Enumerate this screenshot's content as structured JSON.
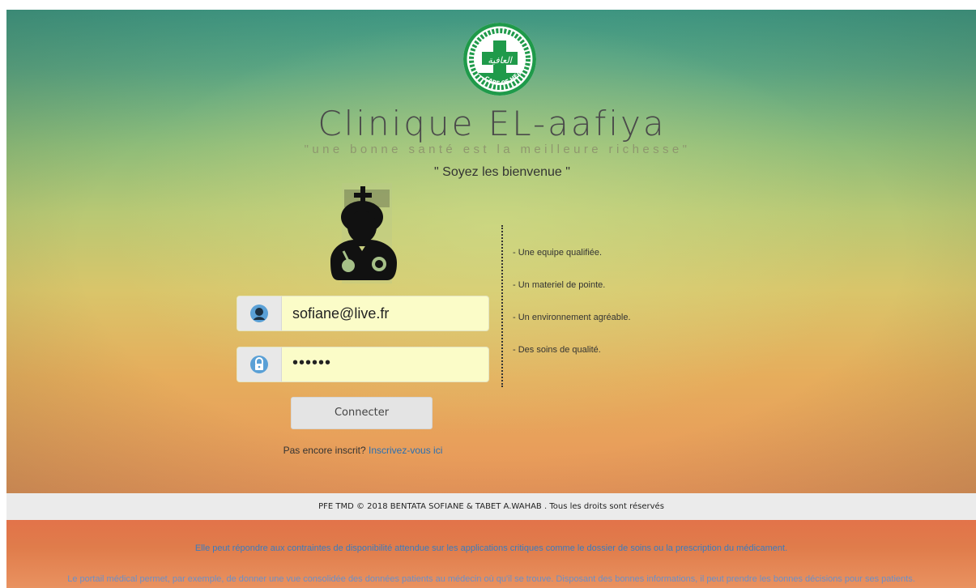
{
  "header": {
    "title": "Clinique EL-aafiya",
    "tagline": "\"une bonne santé est la meilleure richesse\"",
    "welcome": "\" Soyez les bienvenue \"",
    "logo_text": "CARE OF HEALTH"
  },
  "login": {
    "email_value": "sofiane@live.fr",
    "password_value": "••••••",
    "submit_label": "Connecter",
    "signup_prompt": "Pas encore inscrit?",
    "signup_link": "Inscrivez-vous ici"
  },
  "features": [
    "- Une equipe qualifiée.",
    "- Un materiel de pointe.",
    "- Un environnement agréable.",
    "- Des soins de qualité."
  ],
  "footer": {
    "copyright": "PFE TMD © 2018 BENTATA SOFIANE & TABET A.WAHAB . Tous les droits sont réservés",
    "para1": "Elle peut répondre aux contraintes de disponibilité attendue sur les applications critiques comme le dossier de soins ou la prescription du médicament.",
    "para2": "Le portail médical permet, par exemple, de donner une vue consolidée des données patients au médecin où qu'il se trouve. Disposant des bonnes informations, il peut prendre les bonnes décisions pour ses patients."
  },
  "colors": {
    "accent_green": "#1f9a4a",
    "link_blue": "#2a6fb0",
    "input_bg": "#fbfcc8"
  },
  "icons": {
    "logo": "clinic-logo",
    "doctor": "doctor-icon",
    "user": "user-icon",
    "lock": "lock-icon"
  }
}
